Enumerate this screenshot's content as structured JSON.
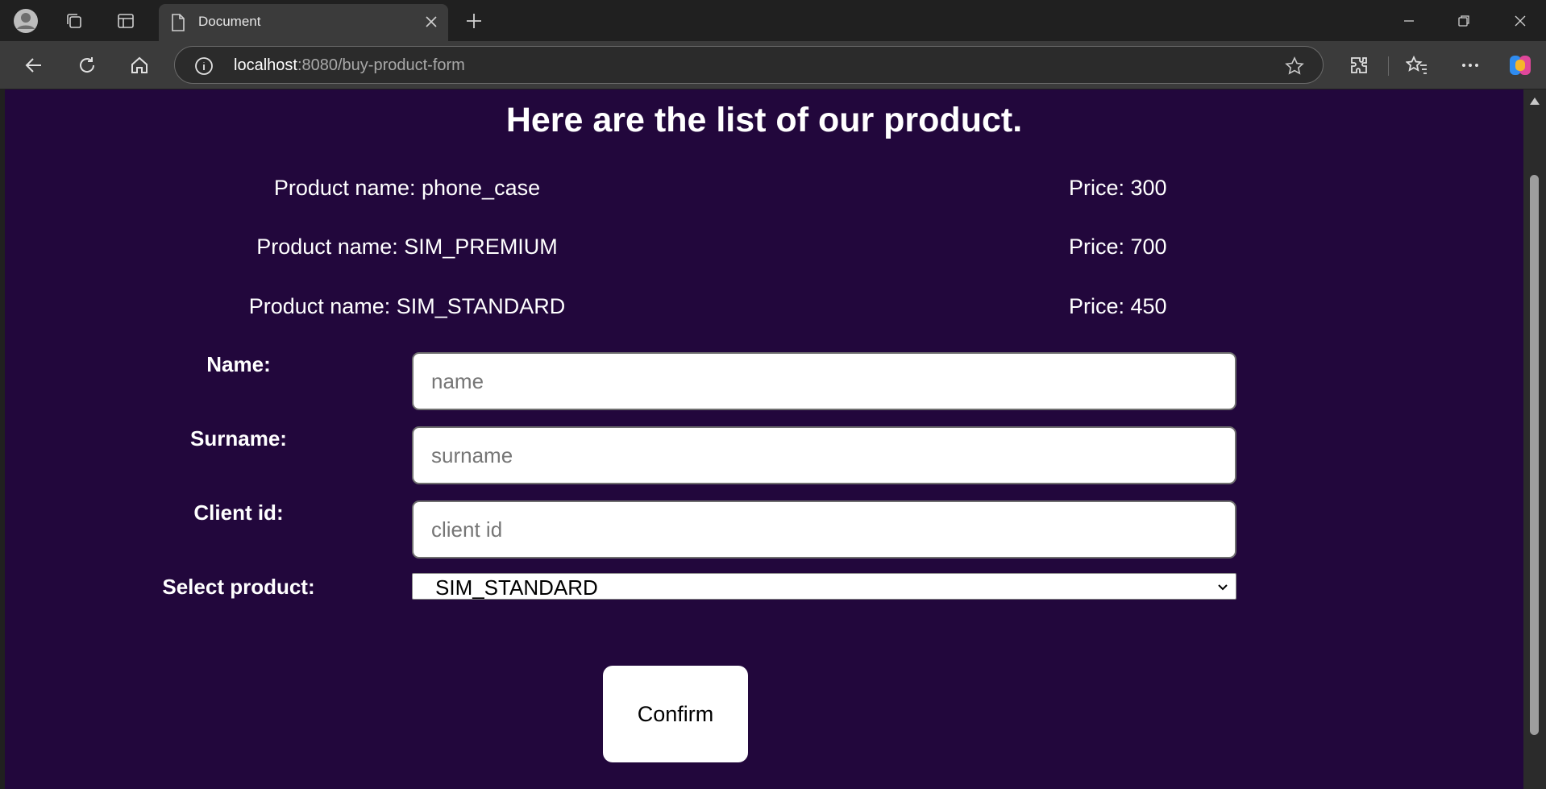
{
  "browser": {
    "tab_title": "Document",
    "url_host": "localhost",
    "url_path": ":8080/buy-product-form",
    "icons": [
      "profile-icon",
      "workspaces-icon",
      "tab-actions-icon",
      "document-icon",
      "close-icon",
      "new-tab-icon",
      "minimize-icon",
      "restore-icon",
      "window-close-icon",
      "back-icon",
      "refresh-icon",
      "home-icon",
      "info-icon",
      "favorite-star-icon",
      "extensions-icon",
      "favorites-icon",
      "more-icon",
      "copilot-icon"
    ]
  },
  "page": {
    "heading": "Here are the list of our product.",
    "background_color": "#22073c",
    "products": [
      {
        "name": "Product name: phone_case",
        "price": "Price: 300"
      },
      {
        "name": "Product name: SIM_PREMIUM",
        "price": "Price: 700"
      },
      {
        "name": "Product name: SIM_STANDARD",
        "price": "Price: 450"
      }
    ],
    "form": {
      "name_label": "Name:",
      "name_placeholder": "name",
      "surname_label": "Surname:",
      "surname_placeholder": "surname",
      "client_id_label": "Client id:",
      "client_id_placeholder": "client id",
      "product_label": "Select product:",
      "product_selected": "SIM_STANDARD",
      "confirm_label": "Confirm"
    }
  }
}
